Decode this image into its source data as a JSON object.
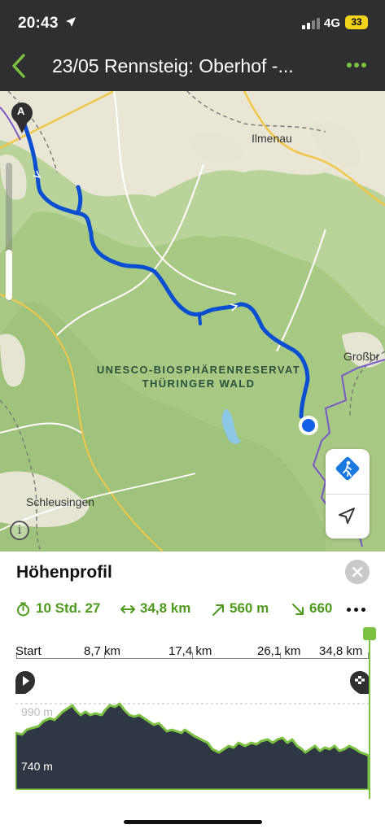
{
  "status_bar": {
    "time": "20:43",
    "network": "4G",
    "battery": "33",
    "icons": [
      "location-arrow-icon",
      "signal-icon",
      "battery-icon"
    ]
  },
  "nav": {
    "title": "23/05 Rennsteig: Oberhof -...",
    "back_icon": "chevron-left-icon",
    "more_icon": "more-horizontal-icon",
    "accent_color": "#7bc142"
  },
  "map": {
    "start_marker": "A",
    "labels": {
      "ilmenau": "Ilmenau",
      "grossbr": "Großbr",
      "schleusingen": "Schleusingen",
      "reserve_line1": "UNESCO-BIOSPHÄRENRESERVAT",
      "reserve_line2": "THÜRINGER WALD"
    },
    "info_label": "i",
    "route_color": "#0a4fd1",
    "controls": [
      "hiking-mode-icon",
      "navigation-arrow-icon"
    ]
  },
  "elevation": {
    "title": "Höhenprofil",
    "stats": {
      "duration": "10 Std. 27",
      "distance": "34,8 km",
      "ascent": "560 m",
      "descent": "660"
    },
    "axis": [
      "Start",
      "8,7 km",
      "17,4 km",
      "26,1 km",
      "34,8 km"
    ],
    "elevation_labels": {
      "upper": "990 m",
      "lower": "740 m"
    },
    "profile_fill": "#2e3743",
    "profile_stroke": "#7bc142"
  }
}
